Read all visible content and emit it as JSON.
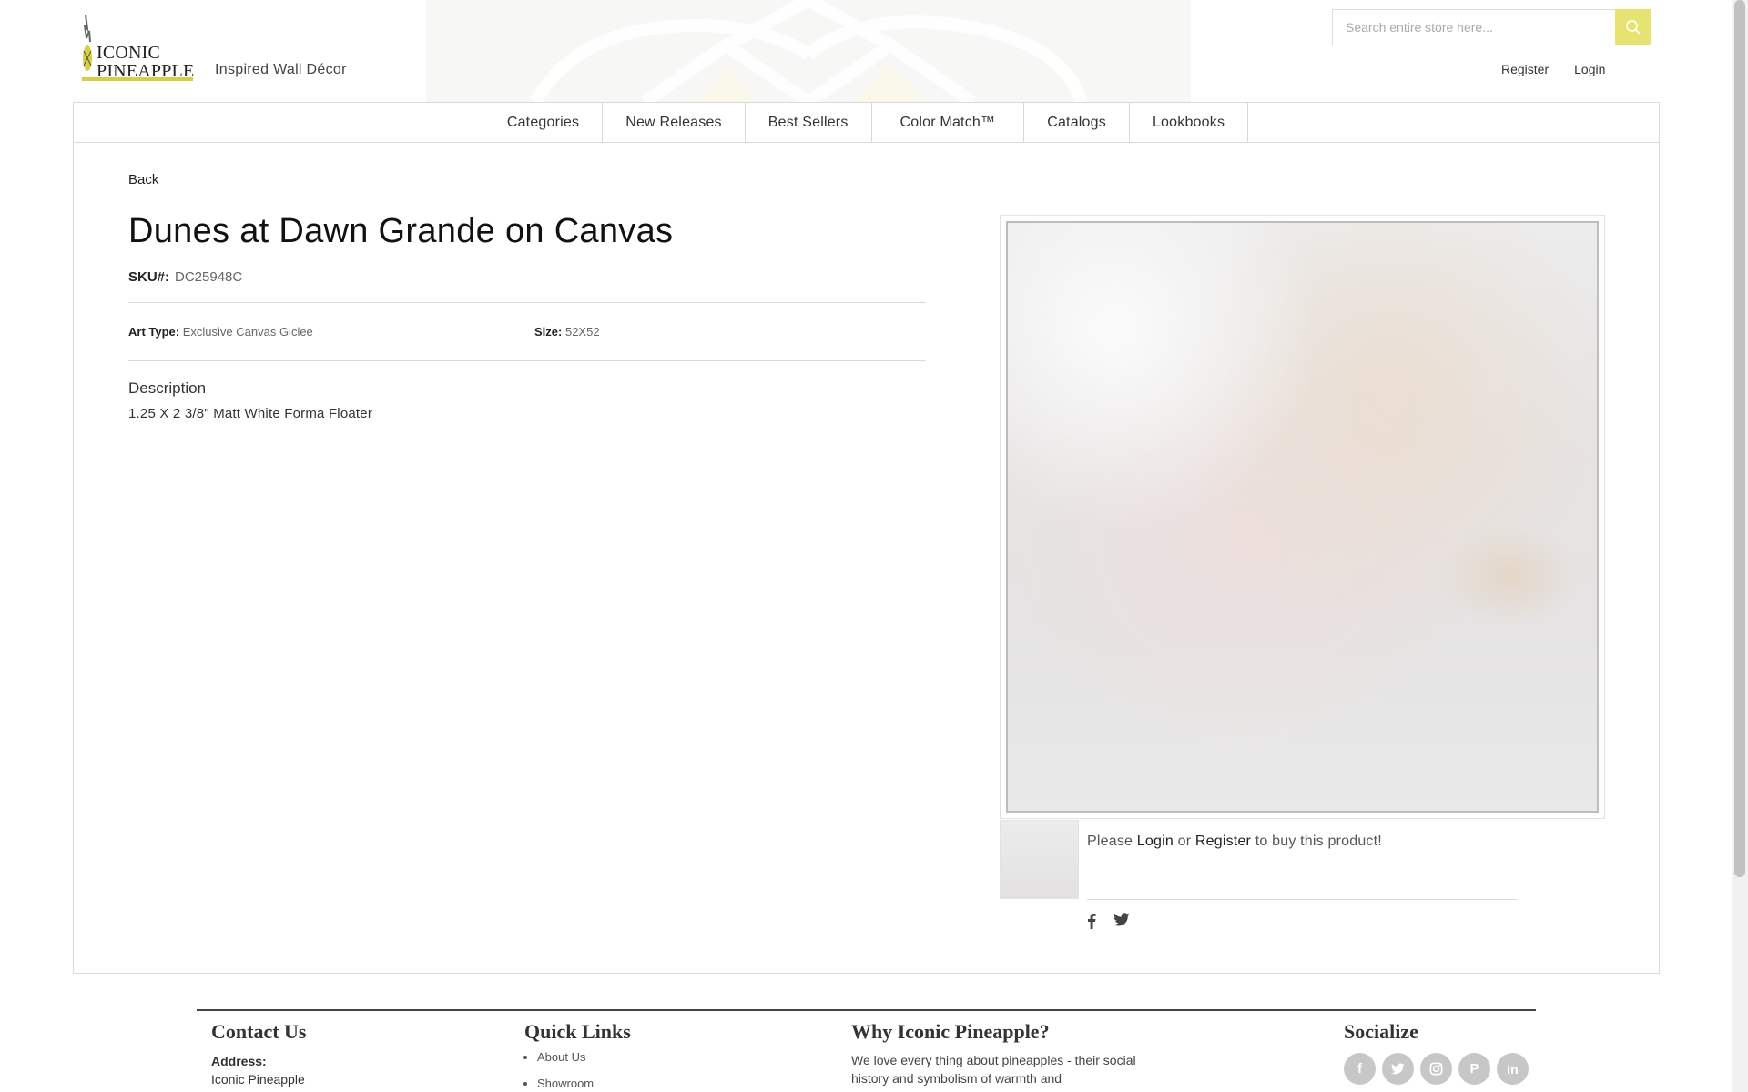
{
  "header": {
    "brand_line1": "ICONIC",
    "brand_line2": "PINEAPPLE",
    "tagline": "Inspired Wall Décor",
    "search_placeholder": "Search entire store here...",
    "register": "Register",
    "login": "Login"
  },
  "nav": {
    "items": [
      "Categories",
      "New Releases",
      "Best Sellers",
      "Color Match™",
      "Catalogs",
      "Lookbooks"
    ]
  },
  "product": {
    "back": "Back",
    "title": "Dunes at Dawn Grande on Canvas",
    "sku_label": "SKU#:",
    "sku": "DC25948C",
    "art_type_label": "Art Type:",
    "art_type": "Exclusive Canvas Giclee",
    "size_label": "Size:",
    "size": "52X52",
    "description_heading": "Description",
    "description": "1.25 X 2 3/8\" Matt White Forma Floater",
    "buy_prefix": "Please",
    "buy_login": "Login",
    "buy_or": "or",
    "buy_register": "Register",
    "buy_suffix": "to buy this product!"
  },
  "footer": {
    "contact_heading": "Contact Us",
    "address_label": "Address:",
    "address_line1": "Iconic Pineapple",
    "quick_links_heading": "Quick Links",
    "quick_links": [
      "About Us",
      "Showroom"
    ],
    "why_heading": "Why Iconic Pineapple?",
    "why_text": "We love every thing about pineapples - their social history and symbolism of warmth and",
    "socialize_heading": "Socialize",
    "social_icons": [
      "facebook-icon",
      "twitter-icon",
      "instagram-icon",
      "pinterest-icon",
      "linkedin-icon"
    ]
  },
  "colors": {
    "accent": "#e6e373",
    "logo_underline": "#d7cf3e",
    "border": "#d9d9d9",
    "social_circle": "#c7c7c7"
  }
}
